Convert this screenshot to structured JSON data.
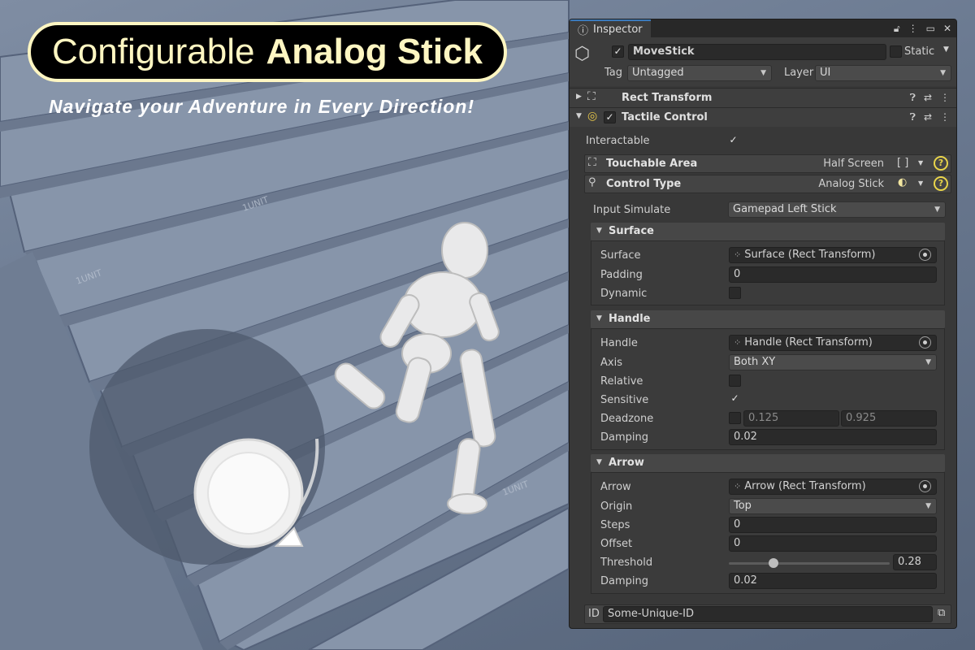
{
  "title": {
    "normal": "Configurable",
    "bold": "Analog Stick"
  },
  "subtitle": "Navigate your Adventure in Every Direction!",
  "scene": {
    "floor_label": "1UNIT"
  },
  "colors": {
    "title_bg": "#000000",
    "title_fg": "#fef6c2",
    "accent_blue": "#3a79bb",
    "help_yellow": "#e8d44a"
  },
  "inspector": {
    "tab_label": "Inspector",
    "gameobject": {
      "active_checked": true,
      "name": "MoveStick",
      "static_label": "Static",
      "tag_label": "Tag",
      "tag_value": "Untagged",
      "layer_label": "Layer",
      "layer_value": "UI"
    },
    "rect_transform": {
      "title": "Rect Transform"
    },
    "tactile": {
      "title": "Tactile Control",
      "interactable_label": "Interactable",
      "interactable_checked": true,
      "touchable_area_label": "Touchable Area",
      "touchable_area_value": "Half Screen",
      "control_type_label": "Control Type",
      "control_type_value": "Analog Stick",
      "input_simulate_label": "Input Simulate",
      "input_simulate_value": "Gamepad Left Stick"
    },
    "surface": {
      "header": "Surface",
      "rows": {
        "surface_label": "Surface",
        "surface_value": "Surface (Rect Transform)",
        "padding_label": "Padding",
        "padding_value": "0",
        "dynamic_label": "Dynamic",
        "dynamic_checked": false
      }
    },
    "handle": {
      "header": "Handle",
      "rows": {
        "handle_label": "Handle",
        "handle_value": "Handle (Rect Transform)",
        "axis_label": "Axis",
        "axis_value": "Both XY",
        "relative_label": "Relative",
        "relative_checked": false,
        "sensitive_label": "Sensitive",
        "sensitive_checked": true,
        "deadzone_label": "Deadzone",
        "deadzone_min": "0.125",
        "deadzone_max": "0.925",
        "damping_label": "Damping",
        "damping_value": "0.02"
      }
    },
    "arrow": {
      "header": "Arrow",
      "rows": {
        "arrow_label": "Arrow",
        "arrow_value": "Arrow (Rect Transform)",
        "origin_label": "Origin",
        "origin_value": "Top",
        "steps_label": "Steps",
        "steps_value": "0",
        "offset_label": "Offset",
        "offset_value": "0",
        "threshold_label": "Threshold",
        "threshold_value": "0.28",
        "threshold_fraction": 0.28,
        "damping_label": "Damping",
        "damping_value": "0.02"
      }
    },
    "id": {
      "label": "ID",
      "value": "Some-Unique-ID"
    }
  }
}
